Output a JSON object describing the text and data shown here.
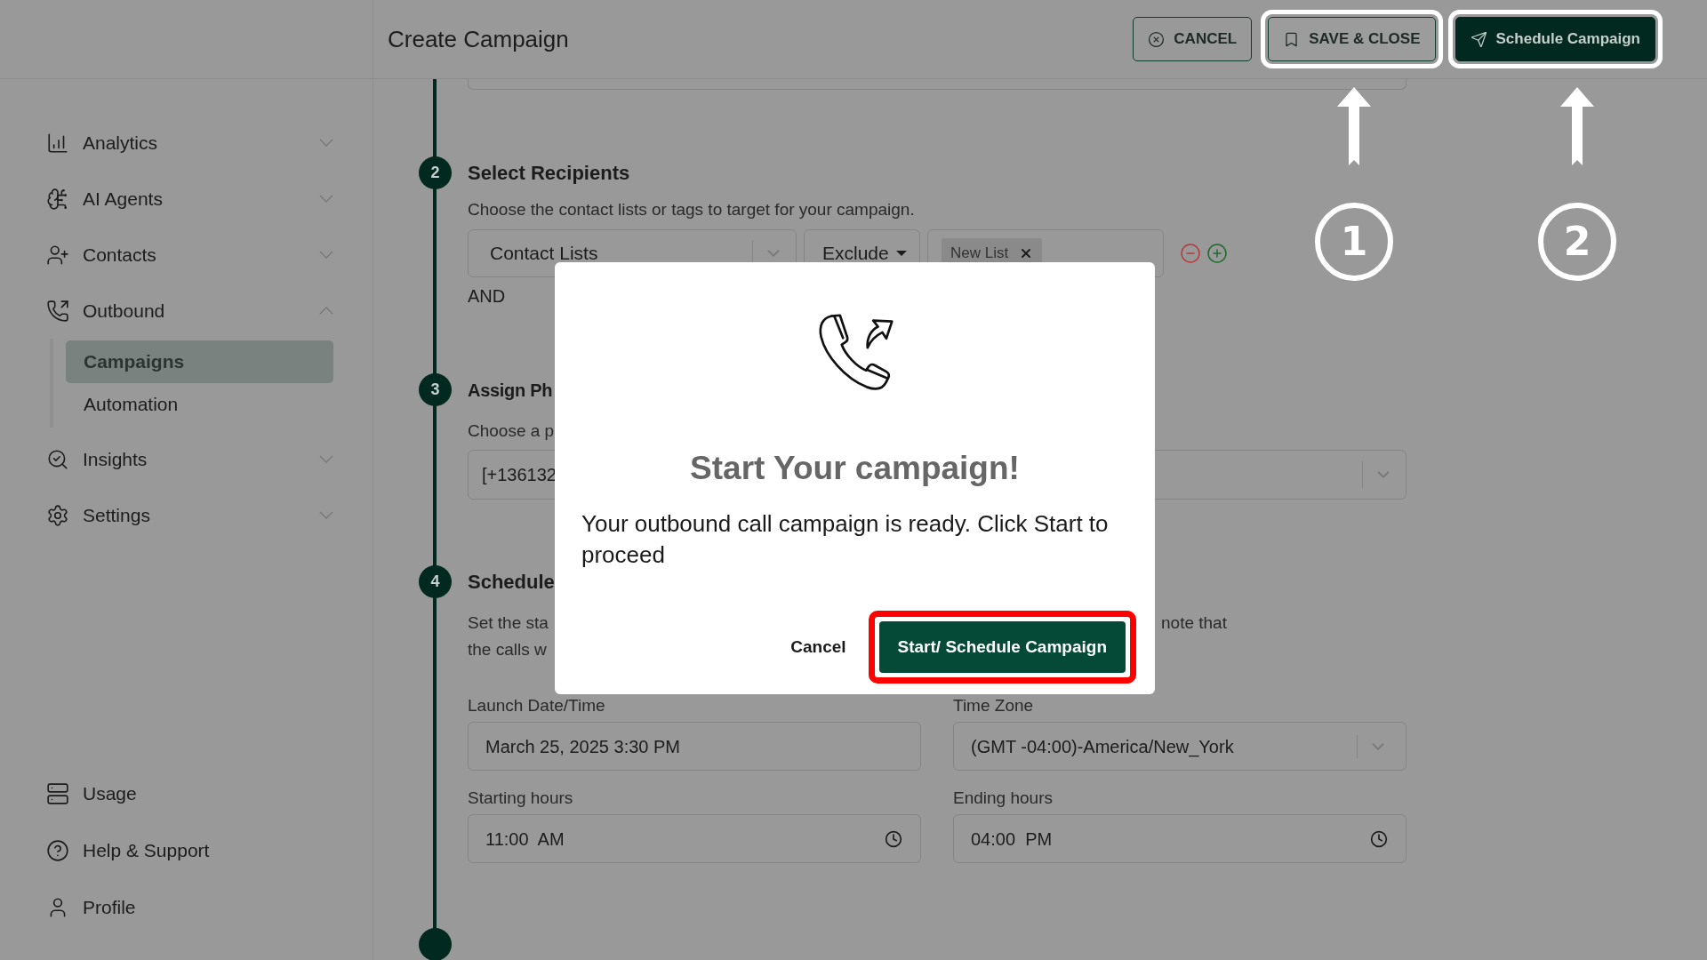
{
  "sidebar": {
    "items": [
      {
        "label": "Analytics",
        "expanded": false
      },
      {
        "label": "AI Agents",
        "expanded": false
      },
      {
        "label": "Contacts",
        "expanded": false
      },
      {
        "label": "Outbound",
        "expanded": true,
        "children": [
          {
            "label": "Campaigns",
            "selected": true
          },
          {
            "label": "Automation",
            "selected": false
          }
        ]
      },
      {
        "label": "Insights",
        "expanded": false
      },
      {
        "label": "Settings",
        "expanded": false
      }
    ],
    "footer_items": [
      {
        "label": "Usage"
      },
      {
        "label": "Help & Support"
      },
      {
        "label": "Profile"
      }
    ]
  },
  "header": {
    "title": "Create Campaign",
    "buttons": [
      {
        "label": "CANCEL",
        "kind": "outline",
        "highlighted": false
      },
      {
        "label": "SAVE & CLOSE",
        "kind": "secondary",
        "highlighted": true
      },
      {
        "label": "Schedule Campaign",
        "kind": "primary",
        "highlighted": true
      }
    ]
  },
  "steps": [
    {
      "number": "2",
      "title": "Select Recipients",
      "description": "Choose the contact lists or tags to target for your campaign.",
      "filter": {
        "source": "Contact Lists",
        "mode": "Exclude",
        "tags": [
          "New List"
        ]
      },
      "joiner": "AND"
    },
    {
      "number": "3",
      "title": "Assign Ph",
      "description": "Choose a p",
      "phone": "[+136132"
    },
    {
      "number": "4",
      "title": "Schedule",
      "description_lines": [
        "Set the sta",
        "the calls w"
      ],
      "description_right": "note that",
      "fields": [
        {
          "label": "Launch Date/Time",
          "value": "March 25, 2025 3:30 PM",
          "kind": "text"
        },
        {
          "label": "Time Zone",
          "value": "(GMT -04:00)-America/New_York",
          "kind": "select"
        },
        {
          "label": "Starting hours",
          "value": "11:00  AM",
          "kind": "time"
        },
        {
          "label": "Ending hours",
          "value": "04:00  PM",
          "kind": "time"
        }
      ]
    }
  ],
  "annotations": [
    {
      "number": "1"
    },
    {
      "number": "2"
    }
  ],
  "modal": {
    "title": "Start Your campaign!",
    "body": "Your outbound call campaign is ready. Click Start to proceed",
    "cancel": "Cancel",
    "confirm": {
      "label": "Start/ Schedule Campaign",
      "highlighted": true
    }
  }
}
